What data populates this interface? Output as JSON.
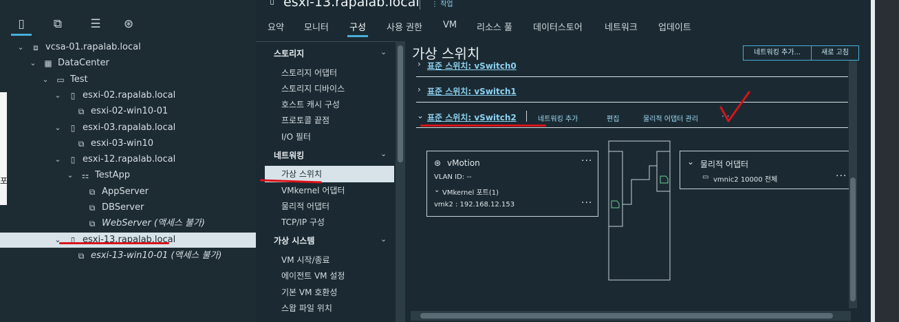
{
  "nav_tabs": [
    {
      "icon": "hosts-and-clusters-icon"
    },
    {
      "icon": "vms-and-templates-icon"
    },
    {
      "icon": "storage-icon"
    },
    {
      "icon": "networking-icon"
    }
  ],
  "tree": [
    {
      "label": "vcsa-01.rapalab.local",
      "icon": "vcenter-icon",
      "chevron": "⌄"
    },
    {
      "label": "DataCenter",
      "icon": "datacenter-icon",
      "chevron": "⌄"
    },
    {
      "label": "Test",
      "icon": "folder-icon",
      "chevron": "⌄"
    },
    {
      "label": "esxi-02.rapalab.local",
      "icon": "host-icon",
      "chevron": "⌄"
    },
    {
      "label": "esxi-02-win10-01",
      "icon": "vm-icon",
      "chevron": ""
    },
    {
      "label": "esxi-03.rapalab.local",
      "icon": "host-icon",
      "chevron": "⌄"
    },
    {
      "label": "esxi-03-win10",
      "icon": "vm-icon",
      "chevron": ""
    },
    {
      "label": "esxi-12.rapalab.local",
      "icon": "host-icon",
      "chevron": "⌄"
    },
    {
      "label": "TestApp",
      "icon": "vapp-icon",
      "chevron": "⌄"
    },
    {
      "label": "AppServer",
      "icon": "vm-icon",
      "chevron": ""
    },
    {
      "label": "DBServer",
      "icon": "vm-icon",
      "chevron": ""
    },
    {
      "label": "WebServer (액세스 불가)",
      "icon": "vm-icon",
      "chevron": ""
    },
    {
      "label": "esxi-13.rapalab.local",
      "icon": "host-icon",
      "chevron": "⌄"
    },
    {
      "label": "esxi-13-win10-01 (액세스 불가)",
      "icon": "vm-icon",
      "chevron": ""
    }
  ],
  "left_edge_text": "포",
  "header": {
    "title": "esxi-13.rapalab.local",
    "actions": "작업",
    "tabs": [
      "요약",
      "모니터",
      "구성",
      "사용 권한",
      "VM",
      "리소스 풀",
      "데이터스토어",
      "네트워크",
      "업데이트"
    ]
  },
  "config_menu": {
    "sections": [
      {
        "title": "스토리지",
        "items": [
          "스토리지 어댑터",
          "스토리지 디바이스",
          "호스트 캐시 구성",
          "프로토콜 끝점",
          "I/O 필터"
        ]
      },
      {
        "title": "네트워킹",
        "items": [
          "가상 스위치",
          "VMkernel 어댑터",
          "물리적 어댑터",
          "TCP/IP 구성"
        ]
      },
      {
        "title": "가상 시스템",
        "items": [
          "VM 시작/종료",
          "에이전트 VM 설정",
          "기본 VM 호환성",
          "스왑 파일 위치"
        ]
      }
    ],
    "selected": "가상 스위치"
  },
  "main": {
    "title": "가상 스위치",
    "add_networking_button": "네트워킹 추가...",
    "refresh_button": "새로 고침",
    "switches": [
      {
        "label": "표준 스위치: vSwitch0",
        "expanded": false
      },
      {
        "label": "표준 스위치: vSwitch1",
        "expanded": false
      },
      {
        "label": "표준 스위치: vSwitch2",
        "expanded": true
      }
    ],
    "switch_actions": [
      "네트워킹 추가",
      "편집",
      "물리적 어댑터 관리",
      "···"
    ],
    "portgroup": {
      "name": "vMotion",
      "vlan": "VLAN ID: --",
      "vmk_header": "VMkernel 포트(1)",
      "vmk": "vmk2 : 192.168.12.153",
      "more": "···"
    },
    "adapters": {
      "header": "물리적 어댑터",
      "nic": "vmnic2 10000 전체",
      "more": "···"
    }
  },
  "colors": {
    "accent": "#49afd9",
    "annotation": "#d8131b",
    "selected_bg": "#d8e3e9"
  }
}
